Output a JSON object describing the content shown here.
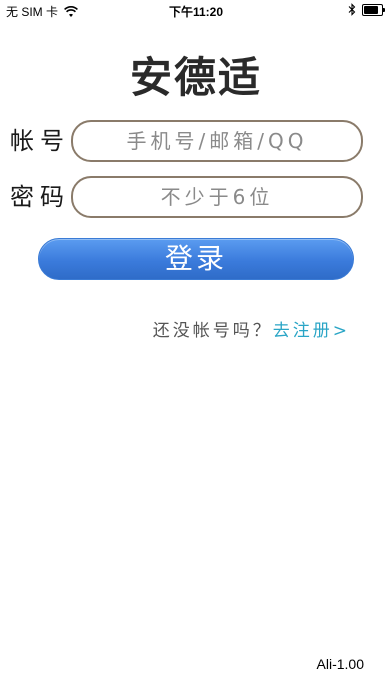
{
  "status_bar": {
    "carrier": "无 SIM 卡",
    "time": "下午11:20",
    "wifi_icon": "wifi-icon",
    "bluetooth_icon": "bluetooth-icon",
    "battery_icon": "battery-icon",
    "battery_level": 0.85
  },
  "app": {
    "title": "安德适",
    "version": "Ali-1.00"
  },
  "login_form": {
    "account_label": "帐号",
    "account_placeholder": "手机号/邮箱/QQ",
    "account_value": "",
    "password_label": "密码",
    "password_placeholder": "不少于6位",
    "password_value": "",
    "login_label": "登录"
  },
  "register": {
    "prompt": "还没帐号吗？",
    "link_label": "去注册>"
  },
  "colors": {
    "login_button": "#3b7bdc",
    "register_link": "#2aa5c6",
    "input_border": "#8a7b6a"
  }
}
